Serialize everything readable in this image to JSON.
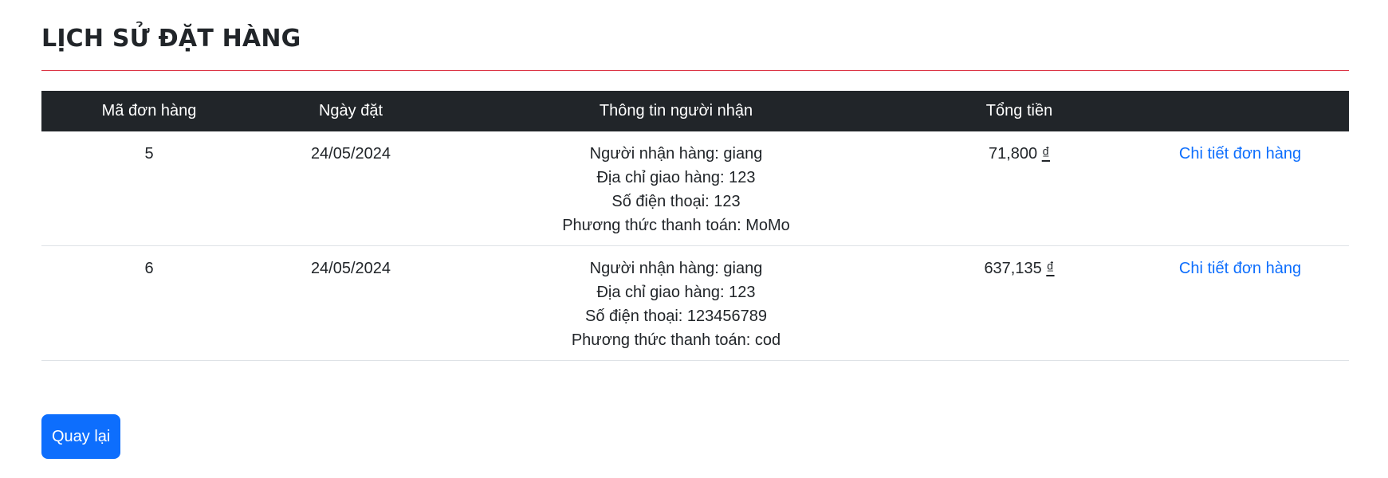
{
  "page": {
    "title": "LỊCH SỬ ĐẶT HÀNG"
  },
  "table": {
    "headers": [
      "Mã đơn hàng",
      "Ngày đặt",
      "Thông tin người nhận",
      "Tổng tiền",
      ""
    ],
    "rows": [
      {
        "id": "5",
        "date": "24/05/2024",
        "recipient": "Người nhận hàng: giang",
        "address": "Địa chỉ giao hàng: 123",
        "phone": "Số điện thoại: 123",
        "payment": "Phương thức thanh toán: MoMo",
        "total": "71,800",
        "currency": "₫",
        "detail_link": "Chi tiết đơn hàng"
      },
      {
        "id": "6",
        "date": "24/05/2024",
        "recipient": "Người nhận hàng: giang",
        "address": "Địa chỉ giao hàng: 123",
        "phone": "Số điện thoại: 123456789",
        "payment": "Phương thức thanh toán: cod",
        "total": "637,135",
        "currency": "₫",
        "detail_link": "Chi tiết đơn hàng"
      }
    ]
  },
  "actions": {
    "back_label": "Quay lại"
  },
  "colors": {
    "header_bg": "#212529",
    "accent_rule": "#dc3545",
    "link": "#0d6efd",
    "button_bg": "#0d6efd"
  }
}
